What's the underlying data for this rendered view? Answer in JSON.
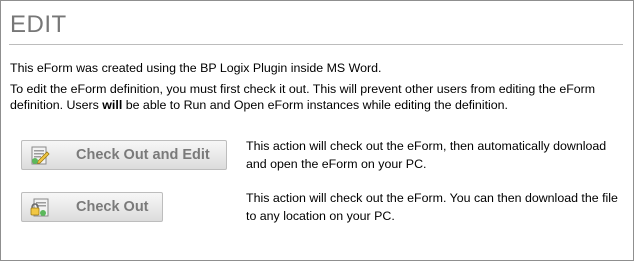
{
  "page": {
    "title": "EDIT",
    "paragraph1": "This eForm was created using the BP Logix Plugin inside MS Word.",
    "paragraph2_before": "To edit the eForm definition, you must first check it out. This will prevent other users from editing the eForm definition. Users ",
    "paragraph2_bold": "will",
    "paragraph2_after": " be able to Run and Open eForm instances while editing the definition."
  },
  "actions": [
    {
      "label": "Check Out and Edit",
      "icon": "document-edit-icon",
      "description": "This action will check out the eForm, then automatically download and open the eForm on your PC."
    },
    {
      "label": "Check Out",
      "icon": "document-lock-icon",
      "description": "This action will check out the eForm. You can then download the file to any location on your PC."
    }
  ],
  "colors": {
    "title": "#777777",
    "button_text": "#7a7a7a",
    "border": "#8f8f8f"
  }
}
